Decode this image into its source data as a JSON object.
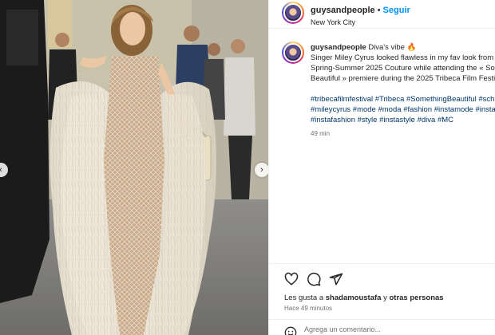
{
  "post": {
    "username": "guysandpeople",
    "follow_label": "Seguir",
    "dot": "•",
    "location": "New York City"
  },
  "caption": {
    "username": "guysandpeople",
    "lines": [
      "Diva's vibe 🔥",
      "Singer Miley Cyrus looked flawless in my fav look from",
      "Spring-Summer 2025 Couture while attending the « So",
      "Beautiful » premiere during the 2025 Tribeca Film Festi"
    ],
    "hashtag_lines": [
      "#tribecafilmfestival #Tribeca #SomethingBeautiful #sch",
      "#mileycyrus #mode #moda #fashion #instamode #instaf",
      "#instafashion #style #instastyle #diva #MC"
    ],
    "time_ago": "49 min"
  },
  "actions": {
    "likes_prefix": "Les gusta a ",
    "liked_by": "shadamoustafa",
    "likes_suffix": " y ",
    "others": "otras personas",
    "posted": "Hace 49 minutos"
  },
  "comment": {
    "placeholder": "Agrega un comentario..."
  },
  "carousel": {
    "prev_icon": "chevron-left-icon",
    "next_icon": "chevron-right-icon"
  },
  "colors": {
    "accent": "#0095f6",
    "hashtag": "#00376b",
    "muted": "#737373",
    "text": "#262626"
  }
}
